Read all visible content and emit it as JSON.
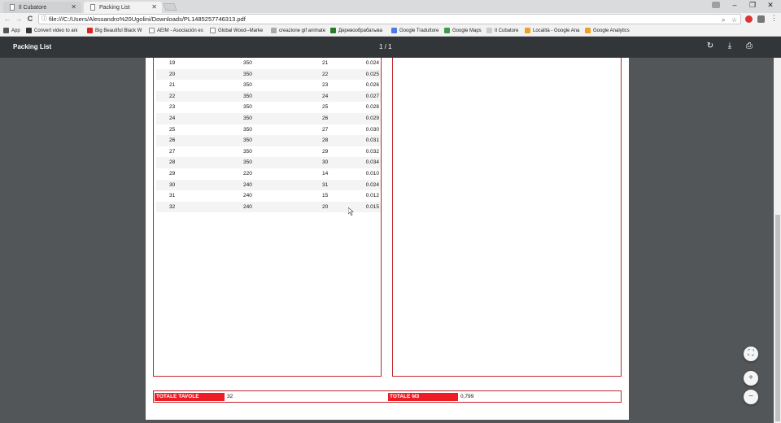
{
  "tabs": [
    {
      "label": "Il Cubatore",
      "active": false
    },
    {
      "label": "Packing List",
      "active": true
    }
  ],
  "window": {
    "minimize": "–",
    "restore": "❐",
    "close": "✕"
  },
  "toolbar": {
    "url": "file:///C:/Users/Alessandro%20Ugolini/Downloads/PL1485257746313.pdf",
    "info_icon": "ⓘ",
    "back": "←",
    "forward": "→",
    "reload": "C"
  },
  "bookmarks": [
    {
      "label": "App",
      "icon_color": "#555"
    },
    {
      "label": "Convert video to ani",
      "icon_color": "#333"
    },
    {
      "label": "Big Beautiful Black W",
      "icon_color": "#d22"
    },
    {
      "label": "AEIM - Asociación es",
      "icon_color": "#888"
    },
    {
      "label": "Global Wood--Marke",
      "icon_color": "#888"
    },
    {
      "label": "creazione gif animate",
      "icon_color": "#aaa"
    },
    {
      "label": "Деревообрабатыва",
      "icon_color": "#2a7a2a"
    },
    {
      "label": "Google Traduttore",
      "icon_color": "#4a7be0"
    },
    {
      "label": "Google Maps",
      "icon_color": "#3c9a4a"
    },
    {
      "label": "Il Cubatore",
      "icon_color": "#ccc"
    },
    {
      "label": "Località - Google Ana",
      "icon_color": "#f0a020"
    },
    {
      "label": "Google Analytics",
      "icon_color": "#f0a020"
    }
  ],
  "pdf": {
    "title": "Packing List",
    "current_page": "1",
    "separator": "/",
    "total_pages": "1"
  },
  "table_rows": [
    [
      "19",
      "350",
      "21",
      "0.024"
    ],
    [
      "20",
      "350",
      "22",
      "0.025"
    ],
    [
      "21",
      "350",
      "23",
      "0.026"
    ],
    [
      "22",
      "350",
      "24",
      "0.027"
    ],
    [
      "23",
      "350",
      "25",
      "0.028"
    ],
    [
      "24",
      "350",
      "26",
      "0.029"
    ],
    [
      "25",
      "350",
      "27",
      "0.030"
    ],
    [
      "26",
      "350",
      "28",
      "0.031"
    ],
    [
      "27",
      "350",
      "29",
      "0.032"
    ],
    [
      "28",
      "350",
      "30",
      "0.034"
    ],
    [
      "29",
      "220",
      "14",
      "0.010"
    ],
    [
      "30",
      "240",
      "31",
      "0.024"
    ],
    [
      "31",
      "240",
      "15",
      "0.012"
    ],
    [
      "32",
      "240",
      "20",
      "0.015"
    ]
  ],
  "totals": {
    "tavole_label": "TOTALE TAVOLE",
    "tavole_value": "32",
    "m3_label": "TOTALE M3",
    "m3_value": "0,799"
  },
  "colors": {
    "accent_red": "#ee1c25",
    "border_red": "#c0262e",
    "pdf_toolbar": "#323639",
    "viewer_bg": "#525659"
  }
}
